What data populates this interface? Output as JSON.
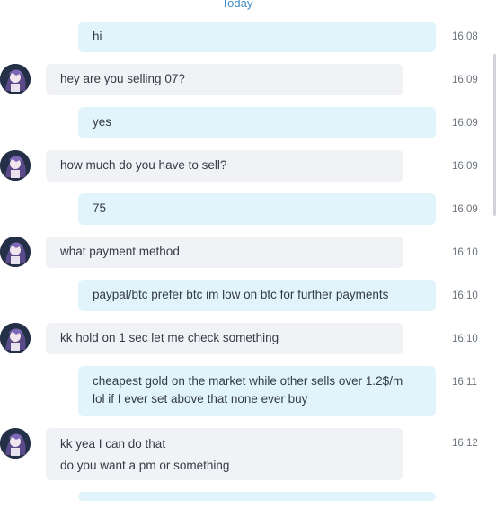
{
  "day_label": "Today",
  "messages": [
    {
      "side": "out",
      "lines": [
        "hi"
      ],
      "time": "16:08"
    },
    {
      "side": "in",
      "lines": [
        "hey are you selling 07?"
      ],
      "time": "16:09"
    },
    {
      "side": "out",
      "lines": [
        "yes"
      ],
      "time": "16:09"
    },
    {
      "side": "in",
      "lines": [
        "how much do you have to sell?"
      ],
      "time": "16:09"
    },
    {
      "side": "out",
      "lines": [
        "75"
      ],
      "time": "16:09"
    },
    {
      "side": "in",
      "lines": [
        "what payment method"
      ],
      "time": "16:10"
    },
    {
      "side": "out",
      "lines": [
        "paypal/btc prefer btc im low on btc for further payments"
      ],
      "time": "16:10"
    },
    {
      "side": "in",
      "lines": [
        "kk hold on 1 sec let me check something"
      ],
      "time": "16:10"
    },
    {
      "side": "out",
      "lines": [
        "cheapest gold on the market while other sells over 1.2$/m",
        "lol if I ever set above that none ever buy"
      ],
      "time": "16:11"
    },
    {
      "side": "in",
      "lines": [
        "kk yea I can do that",
        "do you want a pm or something"
      ],
      "time": "16:12"
    },
    {
      "side": "out",
      "lines": [],
      "time": ""
    }
  ],
  "colors": {
    "outgoing_bubble": "#e1f4fb",
    "incoming_bubble": "#f1f2f6",
    "day_label": "#3b8fc7"
  },
  "icons": {
    "avatar": "anime-character-avatar-icon"
  }
}
